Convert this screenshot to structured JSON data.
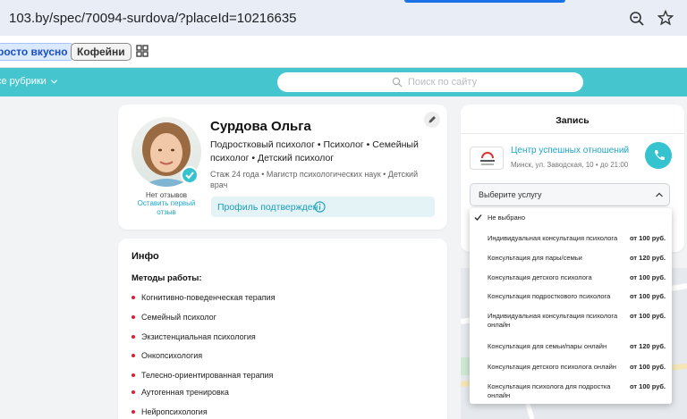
{
  "browser": {
    "url": "103.by/spec/70094-surdova/?placeId=10216635",
    "zoom_icon": "zoom-out-icon",
    "star_icon": "star-icon"
  },
  "bookmarks": {
    "items": [
      "росто вкусно",
      "Кофейни"
    ],
    "apps_icon": "apps-grid-icon"
  },
  "nav": {
    "rubrics_label": "се рубрики",
    "search_placeholder": "Поиск по сайту"
  },
  "profile": {
    "name": "Сурдова Ольга",
    "specialties": "Подростковый психолог • Психолог • Семейный психолог • Детский психолог",
    "experience": "Стаж 24 года  •  Магистр психологических наук • Детский врач",
    "no_reviews": "Нет отзывов",
    "leave_review": "Оставить первый отзыв",
    "verified": "Профиль подтвержден"
  },
  "info": {
    "title": "Инфо",
    "methods_title": "Методы работы:",
    "methods": [
      "Когнитивно-поведенческая терапия",
      "Семейный психолог",
      "Экзистенциальная психология",
      "Онкопсихология",
      "Телесно-ориентированная терапия",
      "Аутогенная тренировка",
      "Нейропсихология"
    ]
  },
  "booking": {
    "title": "Запись",
    "center_name": "Центр успешных отношений",
    "center_address": "Минск, ул. Заводская, 10  •  до 21:00",
    "select_label": "Выберите услугу",
    "options": [
      {
        "label": "Не выбрано",
        "price": "",
        "selected": true
      },
      {
        "label": "Индивидуальная консультация психолога",
        "price": "от 100 руб."
      },
      {
        "label": "Консультация для пары/семьи",
        "price": "от 120 руб."
      },
      {
        "label": "Консультация детского психолога",
        "price": "от 100 руб."
      },
      {
        "label": "Консультация подросткового психолога",
        "price": "от 100 руб."
      },
      {
        "label": "Индивидуальная консультация психолога онлайн",
        "price": "от 100 руб."
      },
      {
        "label": "Консультация для семьи/пары онлайн",
        "price": "от 120 руб."
      },
      {
        "label": "Консультация детского психолога онлайн",
        "price": "от 100 руб."
      },
      {
        "label": "Консультация психолога для подростка онлайн",
        "price": "от 100 руб."
      }
    ]
  },
  "colors": {
    "accent_teal": "#45c6cf",
    "link_blue": "#1fa5c6",
    "bullet_red": "#e11d2e"
  }
}
